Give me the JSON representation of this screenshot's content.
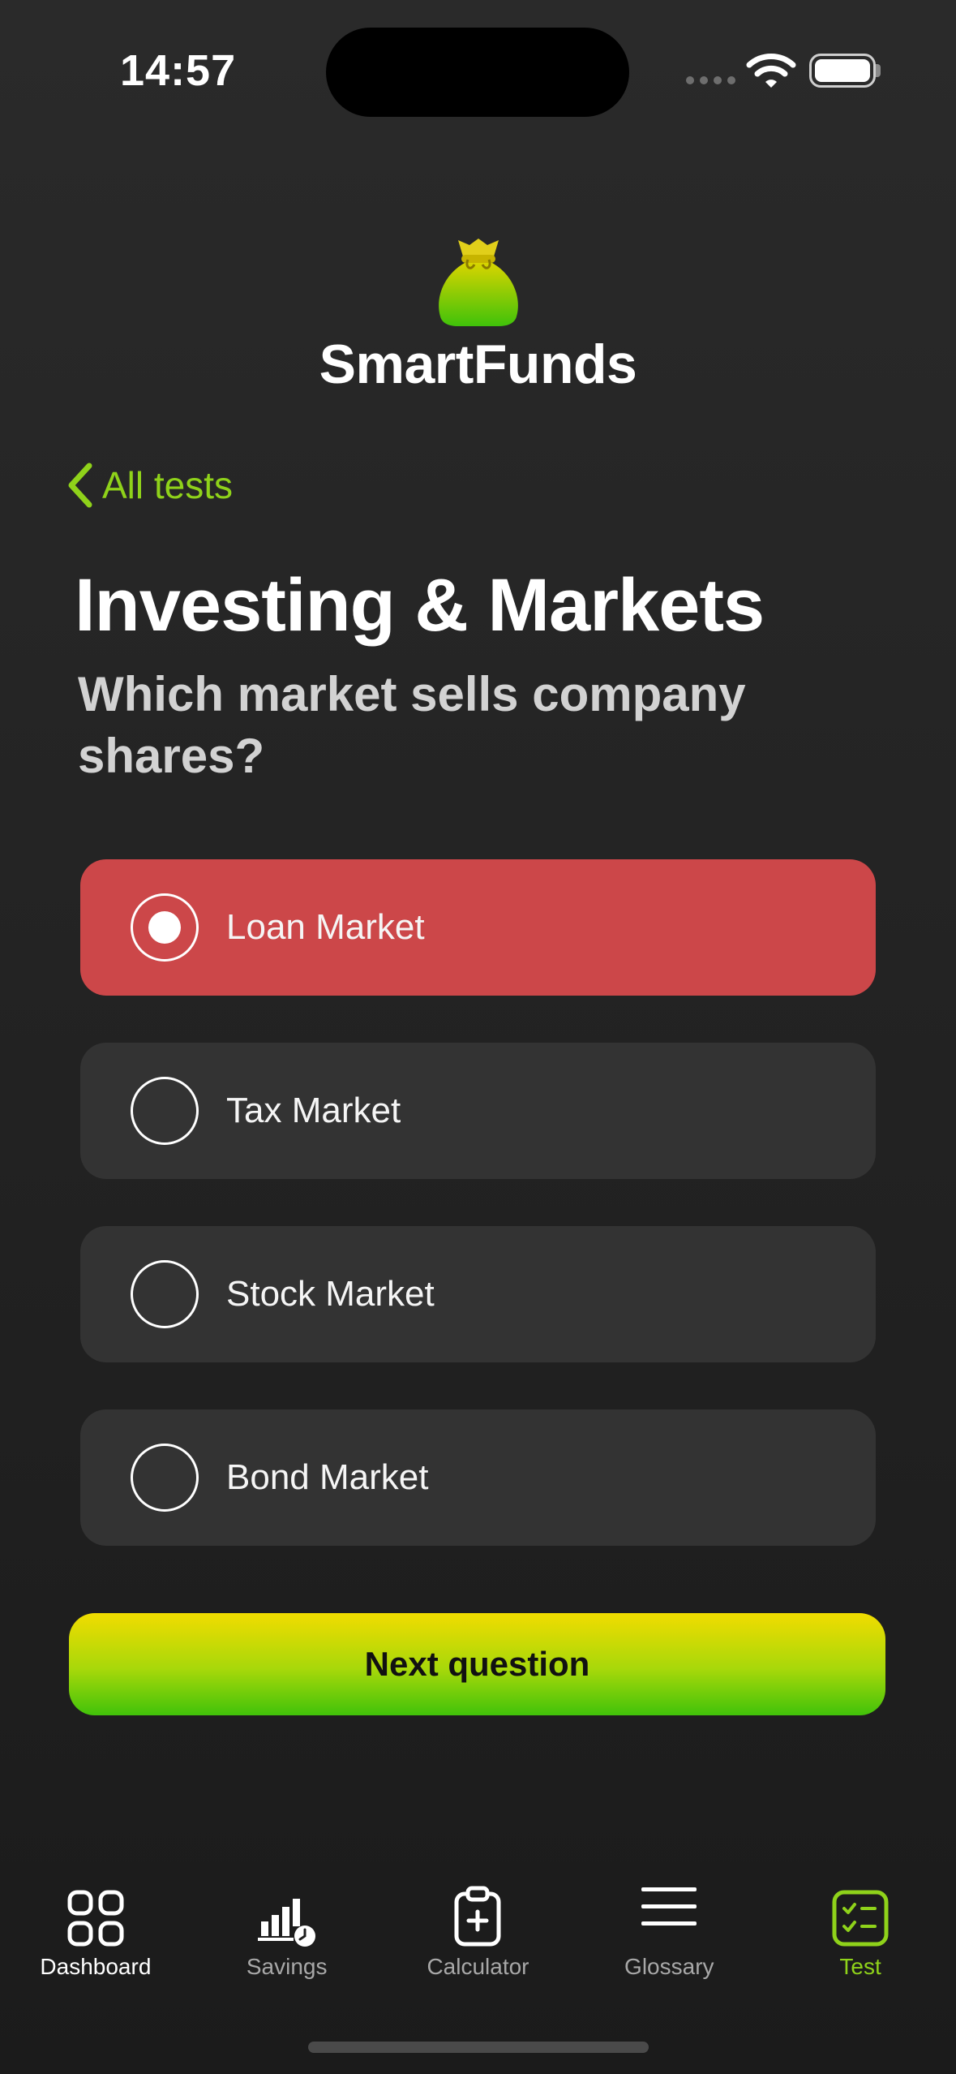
{
  "status_bar": {
    "time": "14:57"
  },
  "brand": {
    "name": "SmartFunds"
  },
  "nav": {
    "back_label": "All tests"
  },
  "quiz": {
    "title": "Investing & Markets",
    "question": "Which market sells company shares?",
    "options": [
      {
        "label": "Loan Market",
        "selected": true
      },
      {
        "label": "Tax Market",
        "selected": false
      },
      {
        "label": "Stock Market",
        "selected": false
      },
      {
        "label": "Bond Market",
        "selected": false
      }
    ],
    "next_label": "Next question"
  },
  "tabs": [
    {
      "label": "Dashboard",
      "icon": "grid-icon"
    },
    {
      "label": "Savings",
      "icon": "bar-chart-clock-icon"
    },
    {
      "label": "Calculator",
      "icon": "clipboard-plus-icon"
    },
    {
      "label": "Glossary",
      "icon": "menu-lines-icon"
    },
    {
      "label": "Test",
      "icon": "checklist-icon",
      "active": true
    }
  ],
  "colors": {
    "accent": "#8fd21a",
    "selected_wrong": "#cc4749",
    "option_bg": "#333333",
    "button_gradient_top": "#f1dc00",
    "button_gradient_bottom": "#41c20a"
  }
}
